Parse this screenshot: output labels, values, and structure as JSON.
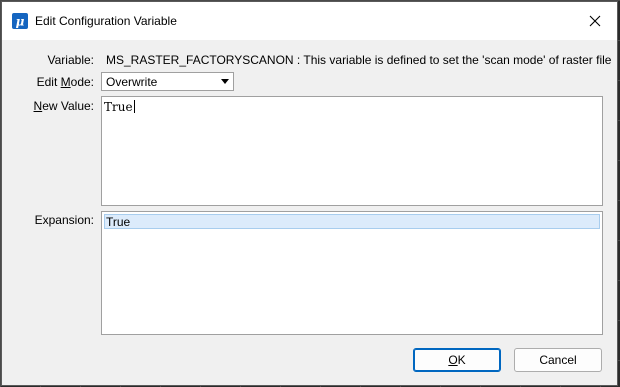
{
  "window": {
    "title": "Edit Configuration Variable"
  },
  "form": {
    "variable_label": "Variable:",
    "variable_text": "MS_RASTER_FACTORYSCANON : This variable is defined to set the 'scan mode' of raster file",
    "edit_mode_label_pre": "Edit ",
    "edit_mode_label_ul": "M",
    "edit_mode_label_post": "ode:",
    "edit_mode_value": "Overwrite",
    "new_value_label_ul": "N",
    "new_value_label_post": "ew Value:",
    "new_value_text": "True",
    "expansion_label": "Expansion:",
    "expansion_items": [
      "True"
    ]
  },
  "buttons": {
    "ok_ul": "O",
    "ok_rest": "K",
    "cancel": "Cancel"
  },
  "colors": {
    "selection": "#dcebfb",
    "accent": "#0067c0"
  }
}
